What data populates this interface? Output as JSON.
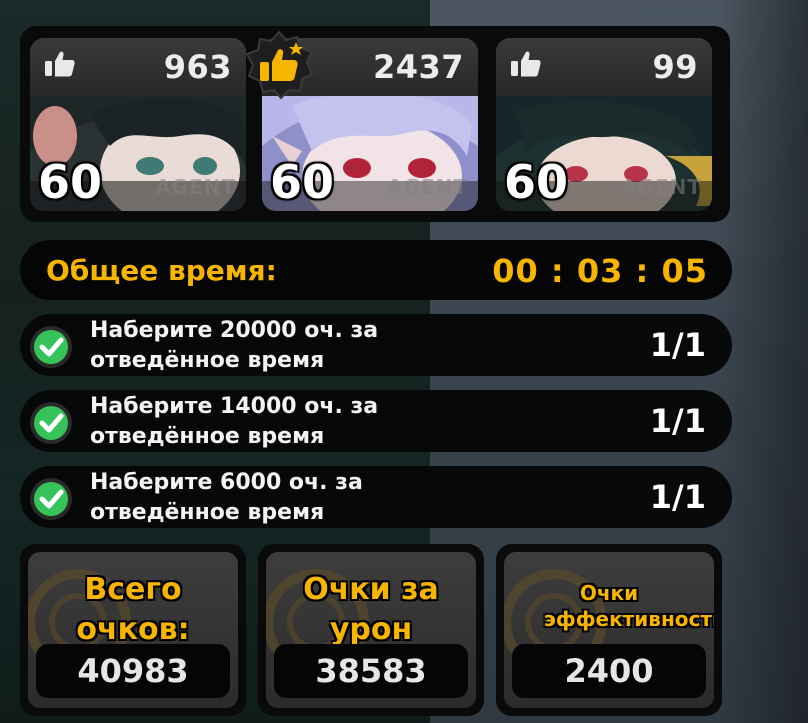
{
  "agents": [
    {
      "likes": "963",
      "level": "60",
      "tag": "AGENT",
      "featured": false
    },
    {
      "likes": "2437",
      "level": "60",
      "tag": "AGENT",
      "featured": true
    },
    {
      "likes": "99",
      "level": "60",
      "tag": "AGENT",
      "featured": false
    }
  ],
  "timer": {
    "label": "Общее время:",
    "value": "00 : 03 : 05"
  },
  "tasks": [
    {
      "text": "Наберите 20000 оч. за отведённое время",
      "progress": "1/1",
      "status": "complete"
    },
    {
      "text": "Наберите 14000 оч. за отведённое время",
      "progress": "1/1",
      "status": "complete"
    },
    {
      "text": "Наберите 6000 оч. за отведённое время",
      "progress": "1/1",
      "status": "complete"
    }
  ],
  "scores": [
    {
      "title": "Всего очков:",
      "value": "40983"
    },
    {
      "title": "Очки за урон",
      "value": "38583"
    },
    {
      "title": "Очки эффективности",
      "value": "2400"
    }
  ],
  "colors": {
    "accent": "#f7b500",
    "check": "#35c35a",
    "panel": "#0a0a0a"
  },
  "icons": {
    "like": "thumbs-up-icon",
    "top_like": "thumbs-up-star-badge-icon",
    "check": "check-circle-icon"
  }
}
